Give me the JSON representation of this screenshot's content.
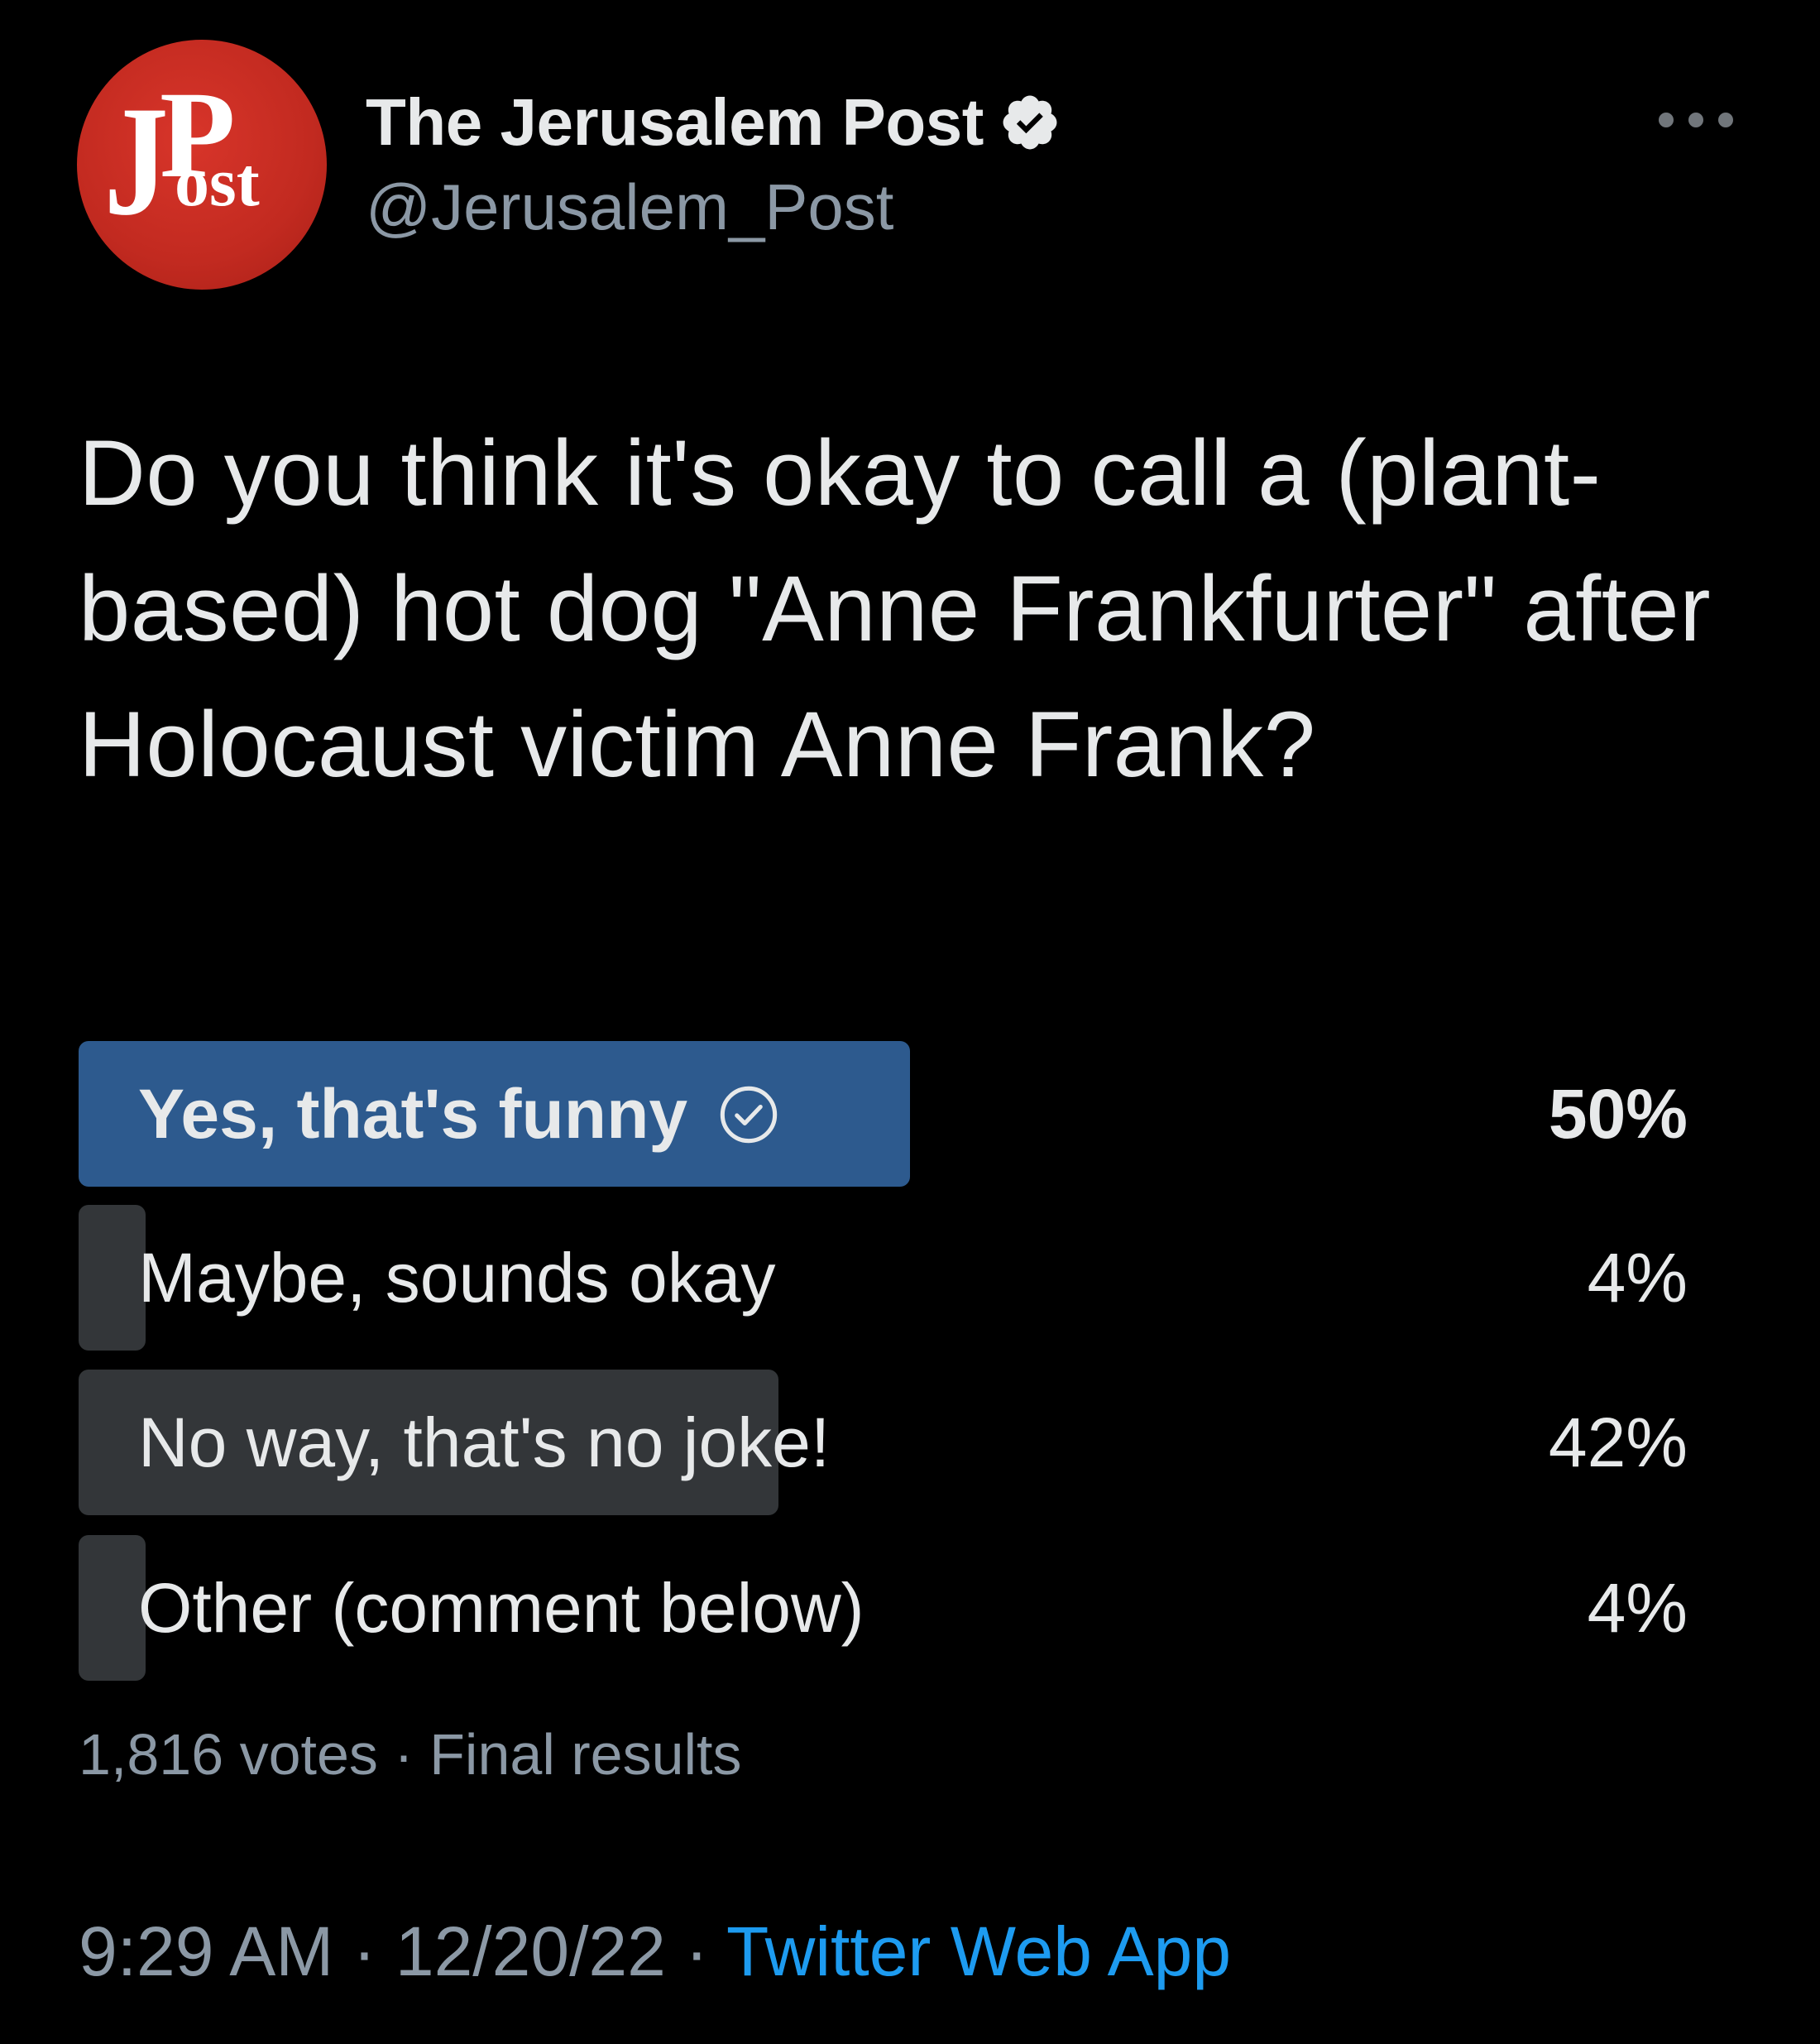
{
  "author": {
    "display_name": "The Jerusalem Post",
    "handle": "@Jerusalem_Post",
    "avatar_logo_text": "JPost",
    "verified": true
  },
  "tweet": {
    "text": "Do you think it's okay to call a (plant-based) hot dog \"Anne Frankfurter\" after Holocaust victim Anne Frank?"
  },
  "poll": {
    "options": [
      {
        "label": "Yes, that's funny",
        "percent_text": "50%",
        "percent": 50,
        "winner": true
      },
      {
        "label": "Maybe, sounds okay",
        "percent_text": "4%",
        "percent": 4,
        "winner": false
      },
      {
        "label": "No way, that's no joke!",
        "percent_text": "42%",
        "percent": 42,
        "winner": false
      },
      {
        "label": "Other (comment below)",
        "percent_text": "4%",
        "percent": 4,
        "winner": false
      }
    ],
    "votes": "1,816 votes",
    "separator": "·",
    "status": "Final results"
  },
  "meta": {
    "time": "9:29 AM",
    "separator": "·",
    "date": "12/20/22",
    "source": "Twitter Web App"
  },
  "colors": {
    "background": "#000000",
    "winner_bar": "#2d5a8e",
    "other_bar": "#333639",
    "link": "#1d9bf0",
    "secondary_text": "#8b98a5",
    "avatar_red": "#c22a20"
  },
  "icons": {
    "more": "more-horizontal-icon",
    "verified": "verified-badge-icon",
    "winner_check": "check-circle-icon"
  }
}
